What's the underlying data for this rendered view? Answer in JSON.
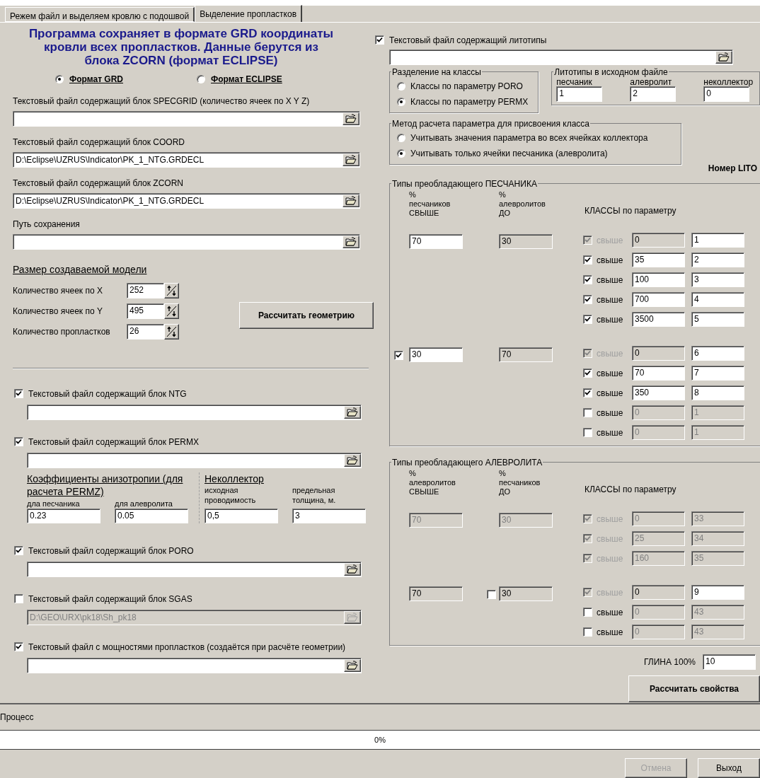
{
  "tabs": [
    {
      "label": "Режем файл и выделяем кровлю с подошвой",
      "selected": false
    },
    {
      "label": "Выделение пропластков",
      "selected": true
    }
  ],
  "header": {
    "title": "Программа сохраняет в формате GRD координаты кровли всех пропластков. Данные берутся из блока ZCORN (формат ECLIPSE)",
    "format_options": [
      {
        "label": "Формат GRD",
        "selected": true
      },
      {
        "label": "Формат ECLIPSE",
        "selected": false
      }
    ]
  },
  "file_fields": [
    {
      "label": "Текстовый файл содержащий блок SPECGRID (количество ячеек по X Y Z)"
    },
    {
      "label": "Текстовый файл содержащий блок COORD",
      "value": "D:\\Eclipse\\UZRUS\\Indicator\\PK_1_NTG.GRDECL"
    },
    {
      "label": "Текстовый файл содержащий блок ZCORN",
      "value": "D:\\Eclipse\\UZRUS\\Indicator\\PK_1_NTG.GRDECL"
    },
    {
      "label": "Путь сохранения"
    }
  ],
  "model_size": {
    "title": "Размер создаваемой модели",
    "counts": [
      {
        "label": "Количество ячеек по X",
        "value": "252"
      },
      {
        "label": "Количество ячеек по Y",
        "value": "495"
      },
      {
        "label": "Количество пропластков",
        "value": "26"
      }
    ],
    "button": "Рассчитать геометрию"
  },
  "block_files": [
    {
      "label": "Текстовый файл содержащий блок NTG",
      "checked": true,
      "disabled": false
    },
    {
      "label": "Текстовый файл содержащий блок PERMX",
      "checked": true,
      "disabled": false,
      "coefficients": {
        "anisotropy": {
          "title": "Коэффициенты анизотропии (для расчета PERMZ)",
          "fields": [
            {
              "label": "дла песчаника",
              "value": "0.23"
            },
            {
              "label": "для алевролита",
              "value": "0.05"
            }
          ]
        },
        "noncollector": {
          "title": "Неколлектор",
          "fields": [
            {
              "label": "исходная проводимость",
              "value": "0,5"
            },
            {
              "label": "предельная толщина, м.",
              "value": "3"
            }
          ]
        }
      }
    },
    {
      "label": "Текстовый файл содержащий блок PORO",
      "checked": true,
      "disabled": false
    },
    {
      "label": "Текстовый файл содержащий блок SGAS",
      "checked": false,
      "disabled": true,
      "value": "D:\\GEO\\URX\\pk18\\Sh_pk18"
    },
    {
      "label": "Текстовый файл с мощностями пропластков (создаётся при расчёте геометрии)",
      "checked": true,
      "disabled": false
    }
  ],
  "litho_file": {
    "label": "Текстовый файл содержащий литотипы",
    "checked": true
  },
  "class_split": {
    "title": "Разделение на классы",
    "options": [
      {
        "label": "Классы по параметру PORO",
        "selected": false
      },
      {
        "label": "Классы по параметру PERMX",
        "selected": true
      }
    ]
  },
  "litho_codes": {
    "title": "Литотипы в исходном файле",
    "fields": [
      {
        "label": "песчаник",
        "value": "1"
      },
      {
        "label": "алевролит",
        "value": "2"
      },
      {
        "label": "неколлектор",
        "value": "0"
      }
    ]
  },
  "method": {
    "title": "Метод расчета параметра для присвоения класса",
    "options": [
      {
        "label": "Учитывать значения параметра во всех ячейках коллектора",
        "selected": false
      },
      {
        "label": "Учитывать только ячейки песчаника (алевролита)",
        "selected": true
      }
    ]
  },
  "lito_number_label": "Номер LITO",
  "groups": [
    {
      "title": "Типы преобладающего  ПЕСЧАНИКА",
      "headers": [
        "%\nпесчаников\nСВЫШЕ",
        "%\nалевролитов\nДО",
        "КЛАССЫ по параметру"
      ],
      "subgroups": [
        {
          "from": {
            "value": "70",
            "kind": "editable"
          },
          "to": {
            "value": "30",
            "kind": "readonly"
          },
          "classes": [
            {
              "label": "свыше",
              "checked": true,
              "disabled": true,
              "threshold": {
                "value": "0",
                "kind": "readonly"
              },
              "lito": {
                "value": "1",
                "kind": "editable"
              }
            },
            {
              "label": "свыше",
              "checked": true,
              "disabled": false,
              "threshold": {
                "value": "35",
                "kind": "editable"
              },
              "lito": {
                "value": "2",
                "kind": "editable"
              }
            },
            {
              "label": "свыше",
              "checked": true,
              "disabled": false,
              "threshold": {
                "value": "100",
                "kind": "editable"
              },
              "lito": {
                "value": "3",
                "kind": "editable"
              }
            },
            {
              "label": "свыше",
              "checked": true,
              "disabled": false,
              "threshold": {
                "value": "700",
                "kind": "editable"
              },
              "lito": {
                "value": "4",
                "kind": "editable"
              }
            },
            {
              "label": "свыше",
              "checked": true,
              "disabled": false,
              "threshold": {
                "value": "3500",
                "kind": "editable"
              },
              "lito": {
                "value": "5",
                "kind": "editable"
              }
            }
          ]
        },
        {
          "from": {
            "value": "30",
            "kind": "editable",
            "checked": true
          },
          "to": {
            "value": "70",
            "kind": "readonly"
          },
          "classes": [
            {
              "label": "свыше",
              "checked": true,
              "disabled": true,
              "threshold": {
                "value": "0",
                "kind": "readonly"
              },
              "lito": {
                "value": "6",
                "kind": "editable"
              }
            },
            {
              "label": "свыше",
              "checked": true,
              "disabled": false,
              "threshold": {
                "value": "70",
                "kind": "editable"
              },
              "lito": {
                "value": "7",
                "kind": "editable"
              }
            },
            {
              "label": "свыше",
              "checked": true,
              "disabled": false,
              "threshold": {
                "value": "350",
                "kind": "editable"
              },
              "lito": {
                "value": "8",
                "kind": "editable"
              }
            },
            {
              "label": "свыше",
              "checked": false,
              "disabled": false,
              "threshold": {
                "value": "0",
                "kind": "disabled"
              },
              "lito": {
                "value": "1",
                "kind": "disabled"
              }
            },
            {
              "label": "свыше",
              "checked": false,
              "disabled": false,
              "threshold": {
                "value": "0",
                "kind": "disabled"
              },
              "lito": {
                "value": "1",
                "kind": "disabled"
              }
            }
          ]
        }
      ]
    },
    {
      "title": "Типы преобладающего  АЛЕВРОЛИТА",
      "headers": [
        "%\nалевролитов\nСВЫШЕ",
        "%\nпесчаников\nДО",
        "КЛАССЫ по параметру"
      ],
      "subgroups": [
        {
          "from": {
            "value": "70",
            "kind": "disabled"
          },
          "to": {
            "value": "30",
            "kind": "disabled"
          },
          "classes": [
            {
              "label": "свыше",
              "checked": true,
              "disabled": true,
              "threshold": {
                "value": "0",
                "kind": "disabled"
              },
              "lito": {
                "value": "33",
                "kind": "disabled"
              }
            },
            {
              "label": "свыше",
              "checked": true,
              "disabled": true,
              "threshold": {
                "value": "25",
                "kind": "disabled"
              },
              "lito": {
                "value": "34",
                "kind": "disabled"
              }
            },
            {
              "label": "свыше",
              "checked": true,
              "disabled": true,
              "threshold": {
                "value": "160",
                "kind": "disabled"
              },
              "lito": {
                "value": "35",
                "kind": "disabled"
              }
            }
          ]
        },
        {
          "from": {
            "value": "70",
            "kind": "readonly"
          },
          "to": {
            "value": "30",
            "kind": "readonly",
            "checked": false
          },
          "classes": [
            {
              "label": "свыше",
              "checked": true,
              "disabled": true,
              "threshold": {
                "value": "0",
                "kind": "readonly"
              },
              "lito": {
                "value": "9",
                "kind": "editable"
              }
            },
            {
              "label": "свыше",
              "checked": false,
              "disabled": false,
              "threshold": {
                "value": "0",
                "kind": "disabled"
              },
              "lito": {
                "value": "43",
                "kind": "disabled"
              }
            },
            {
              "label": "свыше",
              "checked": false,
              "disabled": false,
              "threshold": {
                "value": "0",
                "kind": "disabled"
              },
              "lito": {
                "value": "43",
                "kind": "disabled"
              }
            }
          ]
        }
      ]
    }
  ],
  "clay": {
    "label": "ГЛИНА 100%",
    "value": "10"
  },
  "calc_button": "Рассчитать свойства",
  "process": {
    "label": "Процесс",
    "progress_text": "0%",
    "level": 0
  },
  "buttons": [
    {
      "label": "Отмена",
      "disabled": true
    },
    {
      "label": "Выход",
      "disabled": false
    }
  ]
}
